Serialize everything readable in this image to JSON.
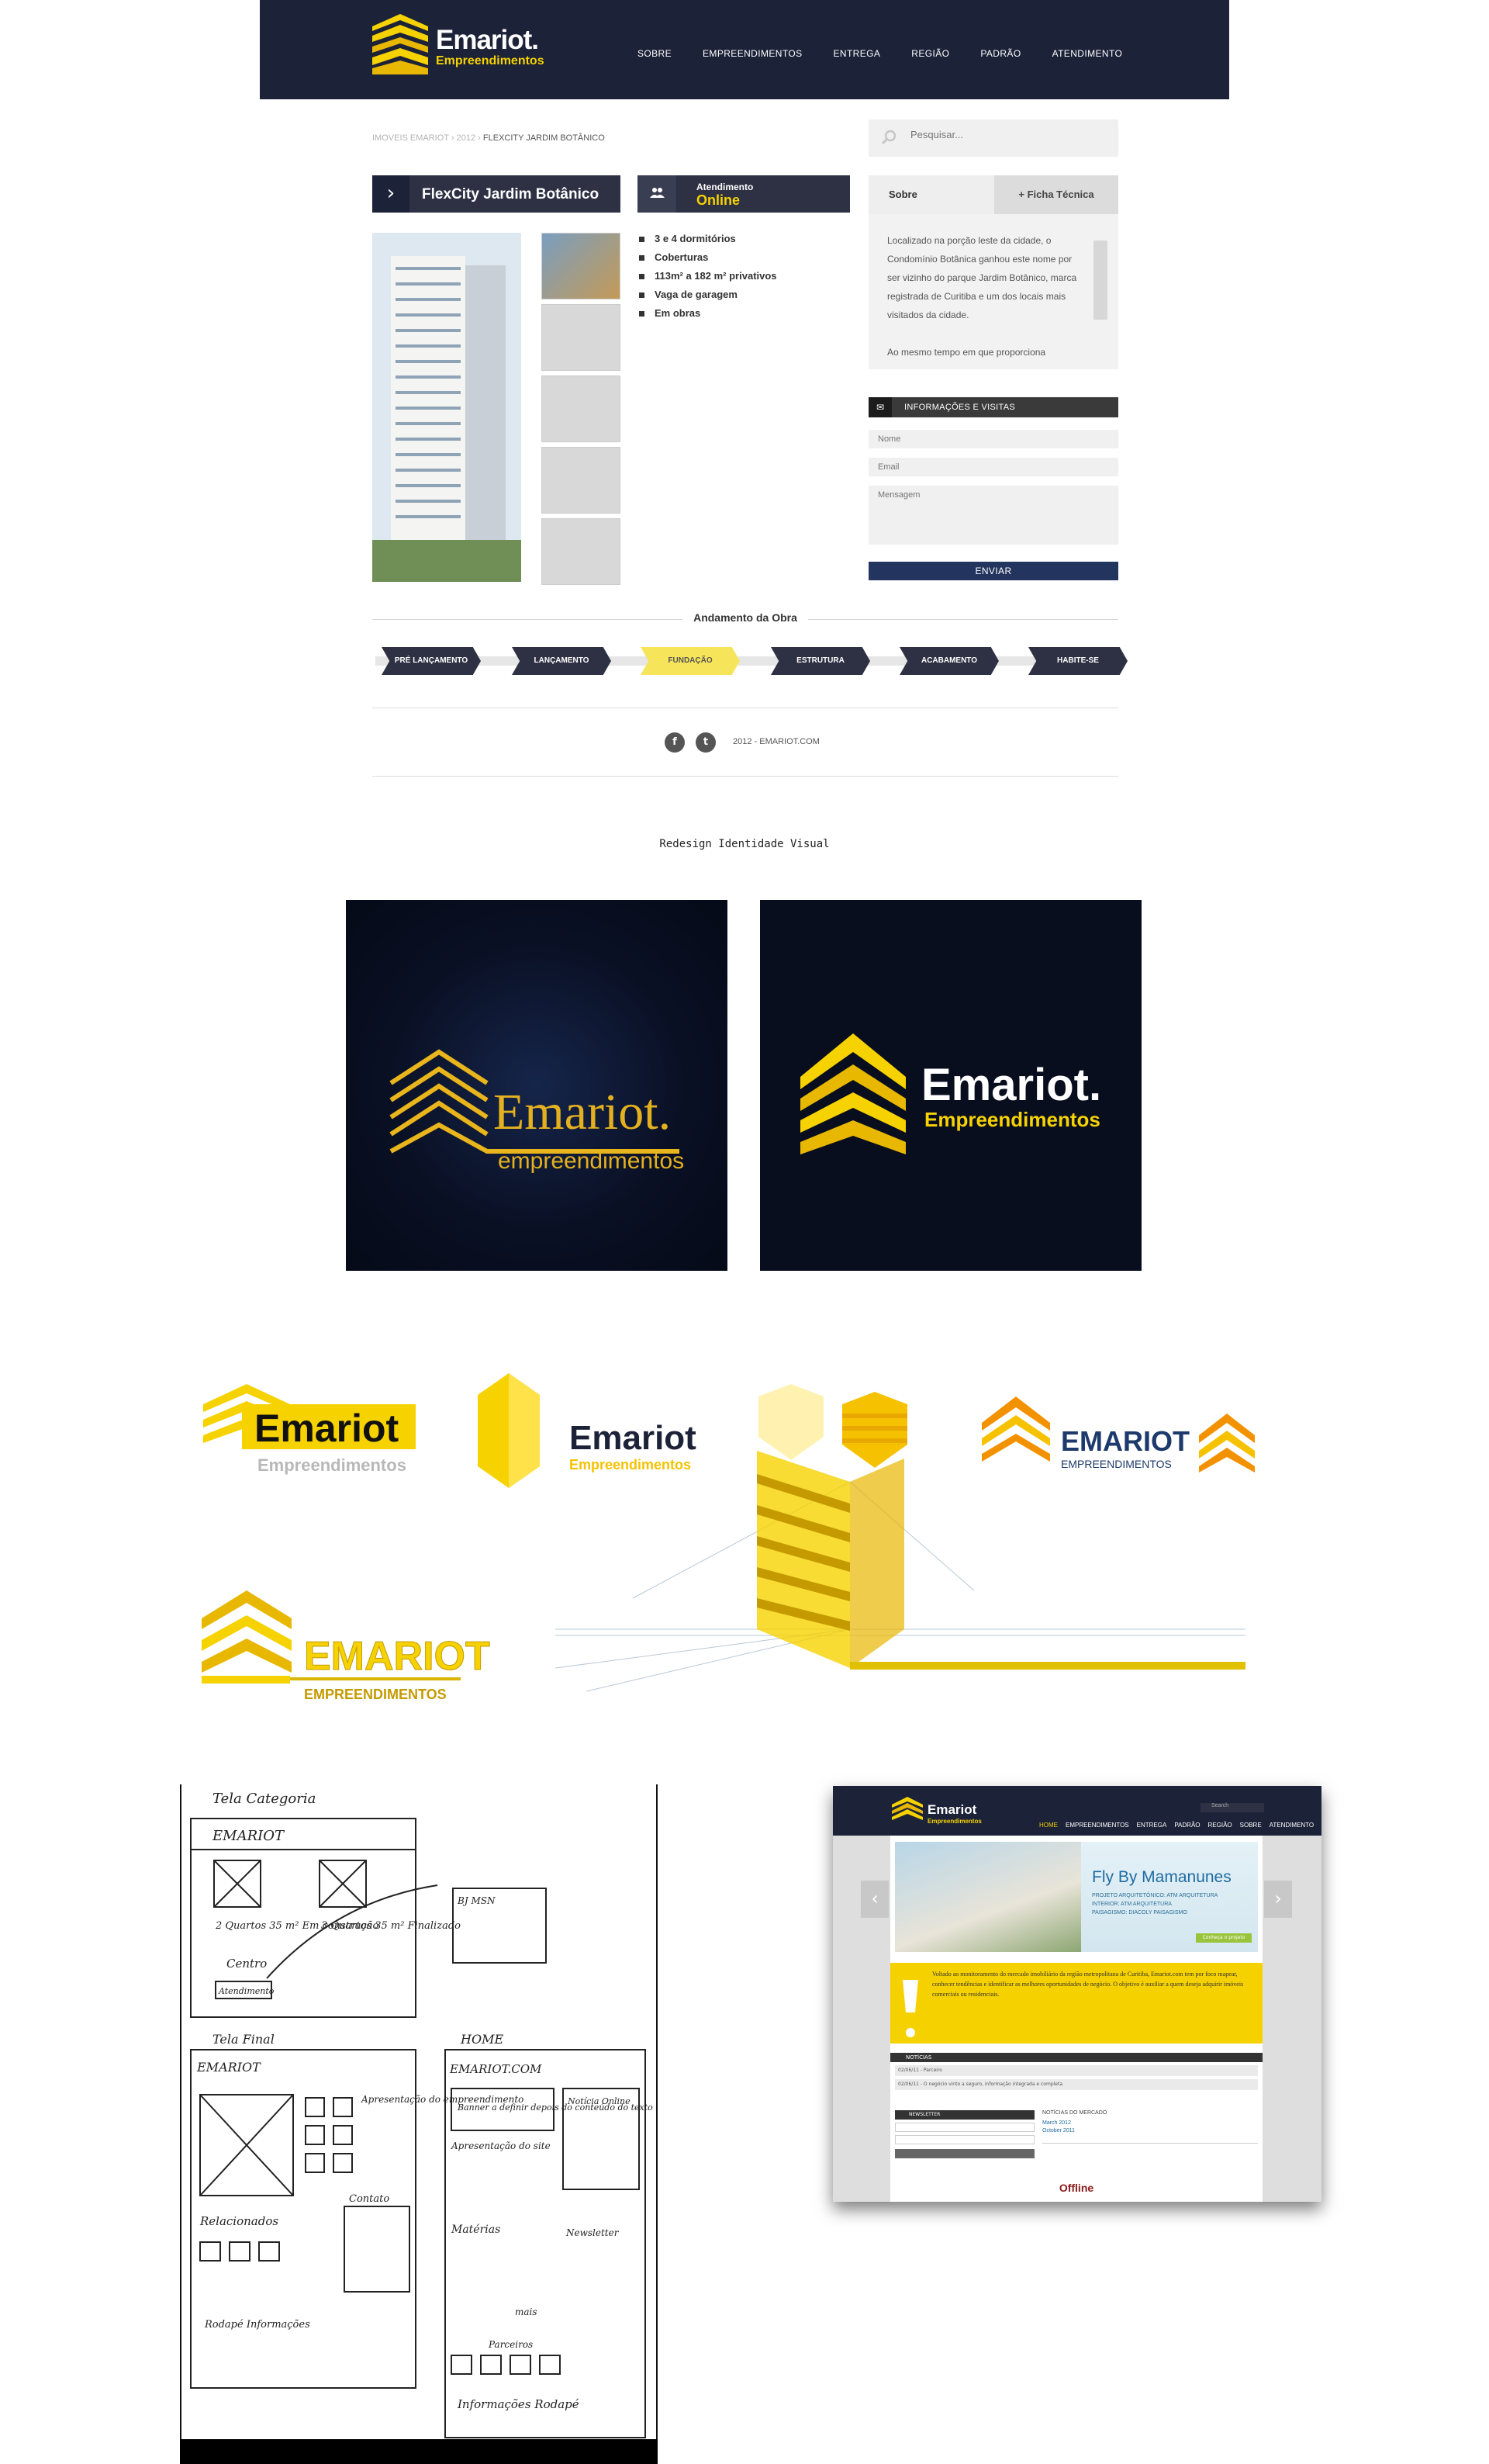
{
  "header": {
    "logo_name": "Emariot.",
    "logo_sub": "Empreendimentos",
    "nav": [
      "SOBRE",
      "EMPREENDIMENTOS",
      "ENTREGA",
      "REGIÃO",
      "PADRÃO",
      "ATENDIMENTO"
    ]
  },
  "breadcrumb": {
    "items": [
      "IMOVEIS EMARIOT",
      "2012"
    ],
    "current": "FLEXCITY JARDIM BOTÂNICO",
    "separator": "›"
  },
  "search": {
    "placeholder": "Pesquisar..."
  },
  "property": {
    "title": "FlexCity Jardim Botânico",
    "atendimento_label": "Atendimento",
    "atendimento_status": "Online",
    "features": [
      "3 e 4 dormitórios",
      "Coberturas",
      "113m² a 182 m² privativos",
      "Vaga de garagem",
      "Em obras"
    ]
  },
  "tabs": {
    "sobre": "Sobre",
    "ficha": "+ Ficha Técnica",
    "content": "Localizado na porção leste da cidade, o Condomínio Botânica ganhou este nome por ser vizinho do parque Jardim Botânico, marca registrada de Curitiba e um dos locais mais visitados da cidade.\n\nAo mesmo tempo em que proporciona"
  },
  "form": {
    "title": "INFORMAÇÕES E VISITAS",
    "name_placeholder": "Nome",
    "email_placeholder": "Email",
    "message_placeholder": "Mensagem",
    "send": "ENVIAR"
  },
  "progress": {
    "title": "Andamento da Obra",
    "steps": [
      "PRÉ LANÇAMENTO",
      "LANÇAMENTO",
      "FUNDAÇÃO",
      "ESTRUTURA",
      "ACABAMENTO",
      "HABITE-SE"
    ],
    "active_index": 2
  },
  "footer": {
    "copyright": "2012 - EMARIOT.COM",
    "social": [
      "f",
      "t"
    ]
  },
  "caption": "Redesign Identidade Visual",
  "logos": {
    "old_name": "Emariot.",
    "old_sub": "empreendimentos",
    "new_name": "Emariot.",
    "new_sub": "Empreendimentos",
    "v1_name": "Emariot",
    "v1_sub": "Empreendimentos",
    "v2_name": "Emariot",
    "v2_sub": "Empreendimentos",
    "v3_name": "EMARIOT",
    "v3_sub": "EMPREENDIMENTOS",
    "v4_name": "EMARIOT",
    "v4_sub": "EMPREENDIMENTOS"
  },
  "sketch": {
    "title1": "Tela Categoria",
    "brand": "EMARIOT",
    "item1": "2 Quartos\n35 m²\nEm construção",
    "item2": "3 Quartos\n35 m²\nFinalizado",
    "centro": "Centro",
    "atendimento": "Atendimento",
    "msn": "BJ MSN",
    "title2": "Tela Final",
    "home": "HOME",
    "brand2": "EMARIOT",
    "site": "EMARIOT.COM",
    "apresent": "Apresentação do empreendimento",
    "banner": "Banner a definir depois do conteúdo do texto",
    "apresent_site": "Apresentação do site",
    "noticia": "Notícia Online",
    "relacionados": "Relacionados",
    "contato": "Contato",
    "materias": "Matérias",
    "newsletter": "Newsletter",
    "mais": "mais",
    "parceiros": "Parceiros",
    "rodape": "Rodapé\nInformações",
    "info_rodape": "Informações Rodapé"
  },
  "mockup": {
    "logo_name": "Emariot",
    "logo_sub": "Empreendimentos",
    "search": "Search",
    "nav": [
      "HOME",
      "EMPREENDIMENTOS",
      "ENTREGA",
      "PADRÃO",
      "REGIÃO",
      "SOBRE",
      "ATENDIMENTO"
    ],
    "banner_title": "Fly By Mamanunes",
    "banner_lines": [
      "PROJETO ARQUITETÔNICO: ATM ARQUITETURA",
      "INTERIOR: ATM ARQUITETURA",
      "PAISAGISMO: DIACOLY PAISAGISMO"
    ],
    "banner_button": "Conheça o projeto",
    "notice": "Voltado ao monitoramento do mercado imobiliário da região metropolitana de Curitiba, Emariot.com tem por foco mapear, conhecer tendências e identificar as melhores oportunidades de negócio. O objetivo é auxiliar a quem deseja adquirir imóveis comerciais ou residenciais.",
    "news_title": "NOTÍCIAS",
    "news": [
      "02/06/11 - Parceiro",
      "02/06/11 - O negócio vinto a seguro, informação integrada e completa"
    ],
    "newsletter": "NEWSLETTER",
    "mercado_title": "NOTÍCIAS DO MERCADO",
    "months": [
      "March 2012",
      "October 2011"
    ],
    "offline": "Offline"
  },
  "colors": {
    "navy": "#1c2238",
    "yellow": "#f6d200",
    "dark_step": "#2d3143",
    "active_step": "#f6e55a"
  }
}
